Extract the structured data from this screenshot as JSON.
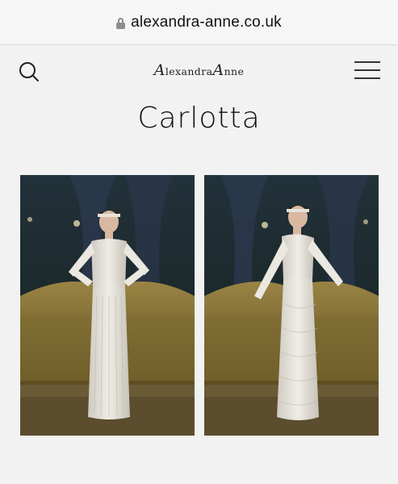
{
  "browser": {
    "url": "alexandra-anne.co.uk"
  },
  "header": {
    "logo_first_initial": "A",
    "logo_first_rest": "lexandra",
    "logo_second_initial": "A",
    "logo_second_rest": "nne"
  },
  "page": {
    "title": "Carlotta"
  },
  "gallery": {
    "images": [
      {
        "subject": "front-view-dress-photo"
      },
      {
        "subject": "side-view-dress-photo"
      }
    ]
  },
  "colors": {
    "background": "#f2f2f2",
    "photo_backdrop": "#1d2a2c",
    "sofa_gold": "#8a7436"
  }
}
